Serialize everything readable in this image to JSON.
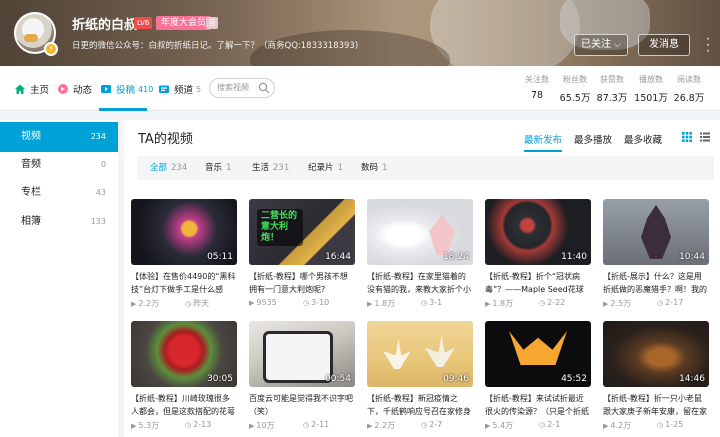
{
  "profile": {
    "username": "折纸的白叔",
    "level_badge": "LV6",
    "vip_badge": "年度大会员",
    "honor_badge": "百",
    "signature": "日更的微信公众号：白叔的折纸日记。了解一下？（商务QQ:1833318393)"
  },
  "actions": {
    "follow_label": "已关注",
    "message_label": "发消息",
    "more_label": "⋮"
  },
  "nav": {
    "tabs": [
      {
        "label": "主页",
        "count": ""
      },
      {
        "label": "动态",
        "count": ""
      },
      {
        "label": "投稿",
        "count": "410"
      },
      {
        "label": "频道",
        "count": "5"
      }
    ],
    "search_placeholder": "搜索视频"
  },
  "stats": [
    {
      "label": "关注数",
      "value": "78"
    },
    {
      "label": "粉丝数",
      "value": "65.5万"
    },
    {
      "label": "获赞数",
      "value": "87.3万"
    },
    {
      "label": "播放数",
      "value": "1501万"
    },
    {
      "label": "阅读数",
      "value": "26.8万"
    }
  ],
  "sidebar": {
    "items": [
      {
        "label": "视频",
        "count": "234"
      },
      {
        "label": "音频",
        "count": "0"
      },
      {
        "label": "专栏",
        "count": "43"
      },
      {
        "label": "相簿",
        "count": "133"
      }
    ]
  },
  "main": {
    "title": "TA的视频",
    "sort": [
      "最新发布",
      "最多播放",
      "最多收藏"
    ],
    "filters": [
      {
        "label": "全部",
        "count": "234"
      },
      {
        "label": "音乐",
        "count": "1"
      },
      {
        "label": "生活",
        "count": "231"
      },
      {
        "label": "纪录片",
        "count": "1"
      },
      {
        "label": "数码",
        "count": "1"
      }
    ]
  },
  "videos": [
    {
      "duration": "05:11",
      "title": "【体验】在售价4490的“黑科技”台灯下做手工是什么感",
      "plays": "2.2万",
      "date": "昨天",
      "overlay": ""
    },
    {
      "duration": "16:44",
      "title": "【折纸-教程】哪个男孩不想拥有一门意大利炮呢?",
      "plays": "9535",
      "date": "3-10",
      "overlay": "二营长的意大利炮！"
    },
    {
      "duration": "18:24",
      "title": "【折纸-教程】在家里猫着的没有猫的我，来教大家折个小",
      "plays": "1.8万",
      "date": "3-1",
      "overlay": ""
    },
    {
      "duration": "11:40",
      "title": "【折纸-教程】折个“冠状病毒”？——Maple Seed花球",
      "plays": "1.8万",
      "date": "2-22",
      "overlay": ""
    },
    {
      "duration": "10:44",
      "title": "【折纸-展示】什么？这是用折纸做的恶魔猎手？啊！我的",
      "plays": "2.5万",
      "date": "2-17",
      "overlay": ""
    },
    {
      "duration": "30:05",
      "title": "【折纸-教程】川崎玫瑰很多人都会，但是这款搭配的花萼",
      "plays": "5.3万",
      "date": "2-13",
      "overlay": ""
    },
    {
      "duration": "00:54",
      "title": "百度云可能是觉得我不识字吧（笑）",
      "plays": "10万",
      "date": "2-11",
      "overlay": ""
    },
    {
      "duration": "09:46",
      "title": "【折纸-教程】新冠疫情之下，千纸鹤响应号召在家修身",
      "plays": "2.2万",
      "date": "2-7",
      "overlay": ""
    },
    {
      "duration": "45:52",
      "title": "【折纸-教程】来试试折最近很火的传染源？（只是个折纸",
      "plays": "5.4万",
      "date": "2-1",
      "overlay": ""
    },
    {
      "duration": "14:46",
      "title": "【折纸-教程】折一只小老鼠跟大家庚子新年安康，留在家",
      "plays": "4.2万",
      "date": "1-25",
      "overlay": ""
    }
  ],
  "colors": {
    "accent": "#00a1d6",
    "vip": "#fb7299",
    "level": "#f04c49"
  }
}
